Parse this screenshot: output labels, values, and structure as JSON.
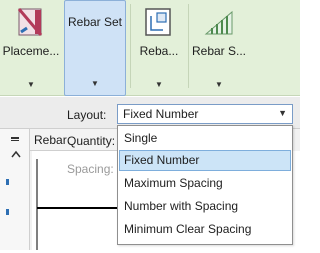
{
  "ribbon": {
    "buttons": [
      {
        "label": "Placeme...",
        "icon": "rebar-placement-icon"
      },
      {
        "label": "Rebar Set",
        "icon": "rebar-set-icon"
      },
      {
        "label": "Reba...",
        "icon": "rebar-icon"
      },
      {
        "label": "Rebar S...",
        "icon": "rebar-shape-icon"
      }
    ]
  },
  "options_bar": {
    "layout_label": "Layout:",
    "layout_value": "Fixed Number",
    "quantity_label": "Quantity:",
    "spacing_label": "Spacing:"
  },
  "view": {
    "tab_label": "Rebar"
  },
  "dropdown": {
    "options": [
      "Single",
      "Fixed Number",
      "Maximum Spacing",
      "Number with Spacing",
      "Minimum Clear Spacing"
    ],
    "selected": "Fixed Number"
  },
  "colors": {
    "ribbon_bg": "#e3f0d9",
    "active_button": "#cfe2f6",
    "selected_option": "#cce4f7"
  }
}
